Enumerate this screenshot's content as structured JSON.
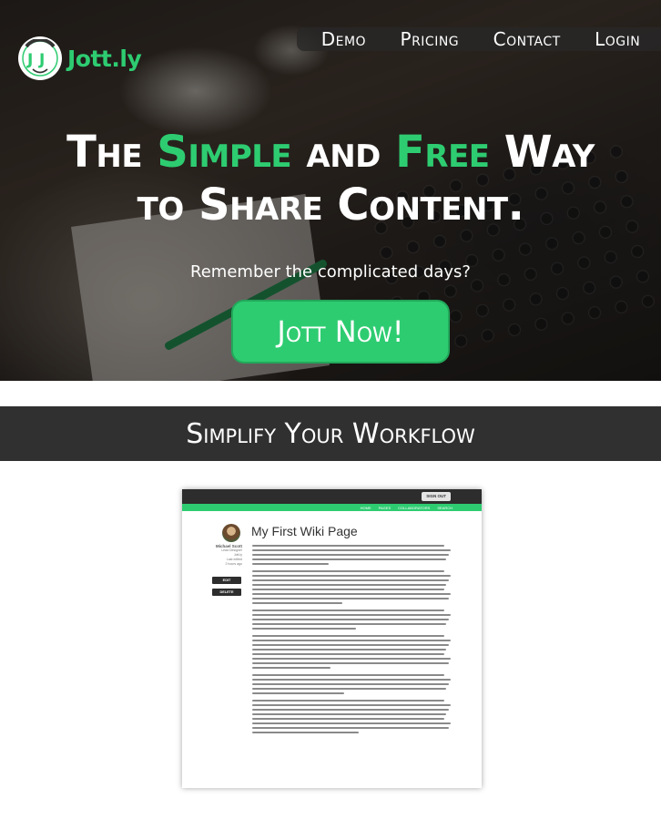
{
  "brand": {
    "name": "Jott.ly",
    "logo_icon": "jj-logo-icon",
    "accent": "#2ecc71"
  },
  "nav": {
    "items": [
      "Demo",
      "Pricing",
      "Contact",
      "Login"
    ]
  },
  "hero": {
    "headline": {
      "w1": "The",
      "w2": "Simple",
      "w3": "and",
      "w4": "Free",
      "w5": "Way",
      "w6": "to Share Content."
    },
    "subtitle": "Remember the complicated days?",
    "cta": "Jott Now!"
  },
  "section": {
    "title": "Simplify Your Workflow"
  },
  "preview": {
    "signout": "SIGN OUT",
    "nav": [
      "HOME",
      "PAGES",
      "COLLABORATORS",
      "SEARCH"
    ],
    "page_title": "My First Wiki Page",
    "author": {
      "name": "Michael Scott",
      "role": "Lead Designer",
      "company": "Jott.ly",
      "edited": "Last edited",
      "ago": "2 hours ago"
    },
    "edit": "EDIT",
    "delete": "DELETE"
  }
}
